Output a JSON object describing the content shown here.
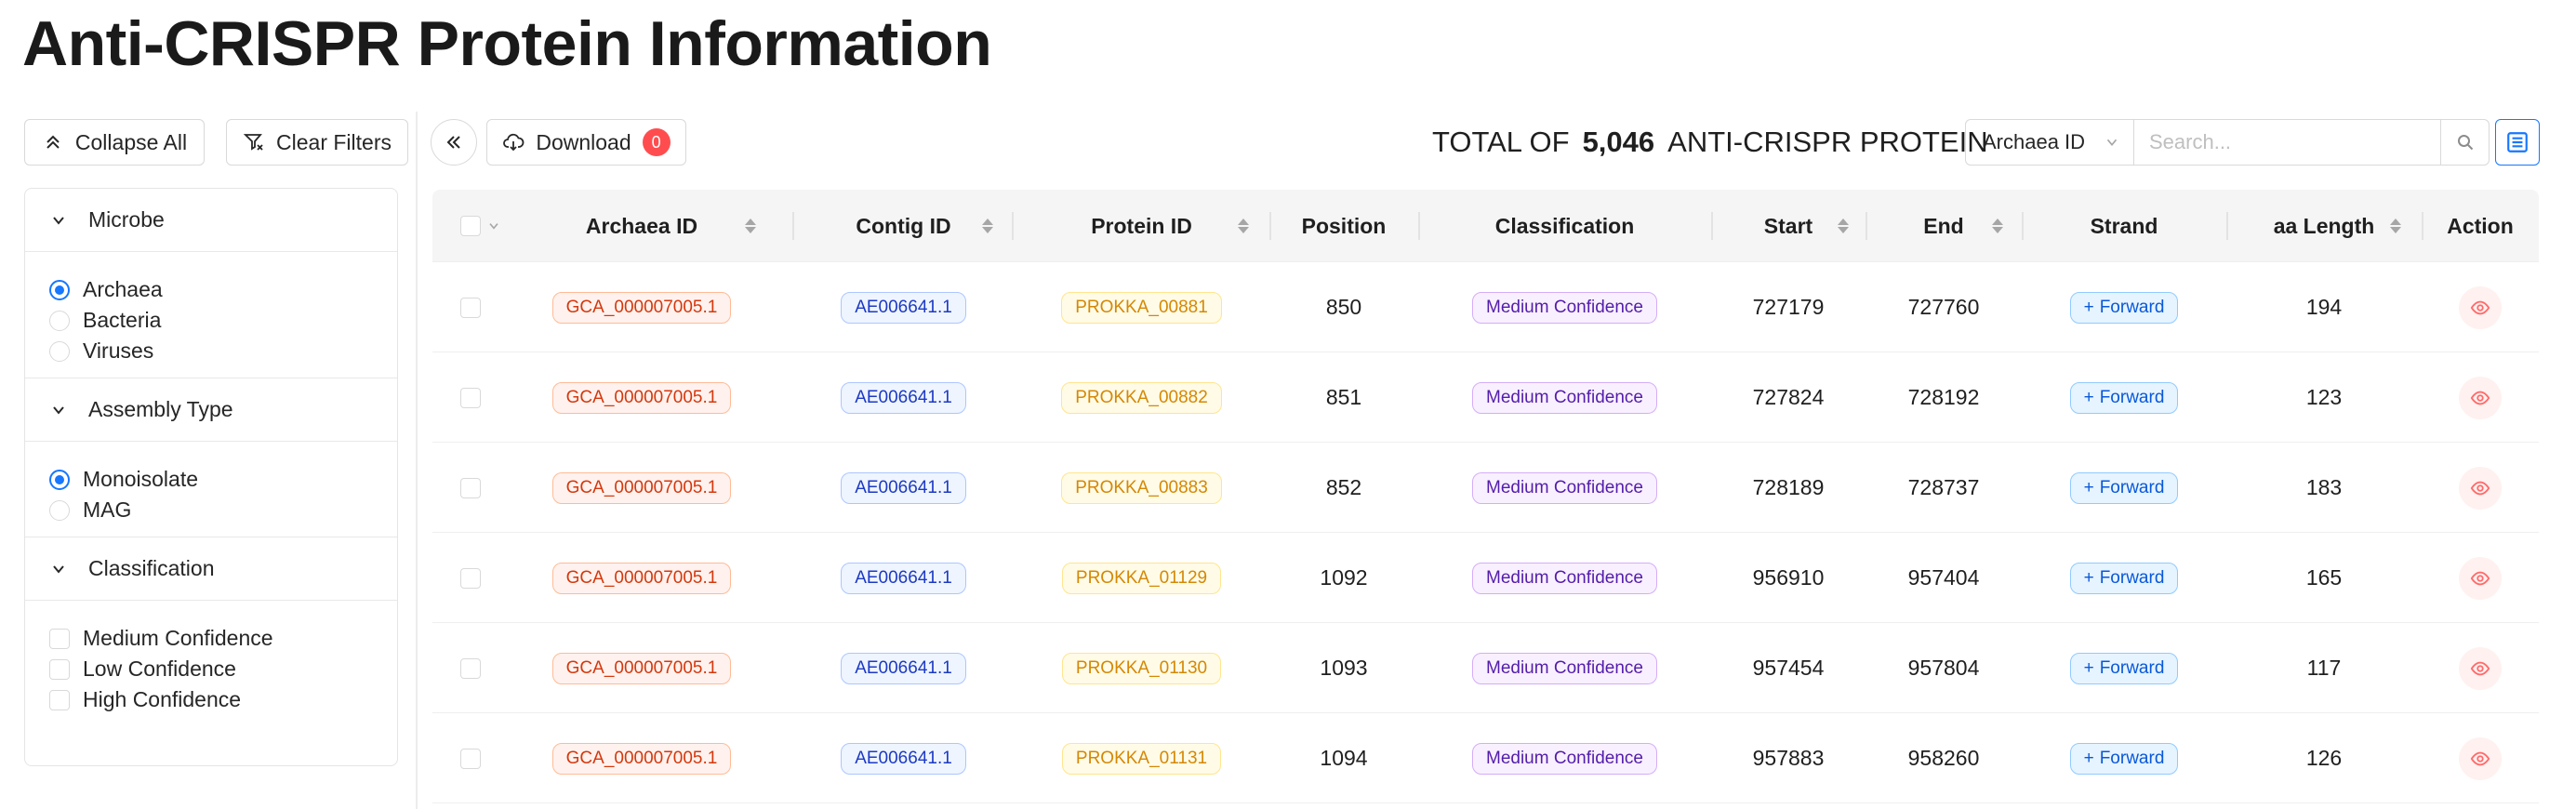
{
  "page": {
    "title": "Anti-CRISPR Protein Information"
  },
  "toolbar": {
    "collapse_label": "Collapse All",
    "clear_label": "Clear Filters",
    "download_label": "Download",
    "download_count": "0"
  },
  "summary": {
    "prefix": "TOTAL OF",
    "count": "5,046",
    "suffix": "ANTI-CRISPR PROTEIN"
  },
  "search": {
    "field": "Archaea ID",
    "placeholder": "Search..."
  },
  "filters": {
    "microbe": {
      "title": "Microbe",
      "options": [
        "Archaea",
        "Bacteria",
        "Viruses"
      ],
      "selected": "Archaea"
    },
    "assembly": {
      "title": "Assembly Type",
      "options": [
        "Monoisolate",
        "MAG"
      ],
      "selected": "Monoisolate"
    },
    "classification": {
      "title": "Classification",
      "options": [
        "Medium Confidence",
        "Low Confidence",
        "High Confidence"
      ]
    }
  },
  "table": {
    "columns": [
      "Archaea ID",
      "Contig ID",
      "Protein ID",
      "Position",
      "Classification",
      "Start",
      "End",
      "Strand",
      "aa Length",
      "Action"
    ],
    "rows": [
      {
        "archaea": "GCA_000007005.1",
        "contig": "AE006641.1",
        "protein": "PROKKA_00881",
        "position": "850",
        "classification": "Medium Confidence",
        "start": "727179",
        "end": "727760",
        "strand": "Forward",
        "aa_length": "194"
      },
      {
        "archaea": "GCA_000007005.1",
        "contig": "AE006641.1",
        "protein": "PROKKA_00882",
        "position": "851",
        "classification": "Medium Confidence",
        "start": "727824",
        "end": "728192",
        "strand": "Forward",
        "aa_length": "123"
      },
      {
        "archaea": "GCA_000007005.1",
        "contig": "AE006641.1",
        "protein": "PROKKA_00883",
        "position": "852",
        "classification": "Medium Confidence",
        "start": "728189",
        "end": "728737",
        "strand": "Forward",
        "aa_length": "183"
      },
      {
        "archaea": "GCA_000007005.1",
        "contig": "AE006641.1",
        "protein": "PROKKA_01129",
        "position": "1092",
        "classification": "Medium Confidence",
        "start": "956910",
        "end": "957404",
        "strand": "Forward",
        "aa_length": "165"
      },
      {
        "archaea": "GCA_000007005.1",
        "contig": "AE006641.1",
        "protein": "PROKKA_01130",
        "position": "1093",
        "classification": "Medium Confidence",
        "start": "957454",
        "end": "957804",
        "strand": "Forward",
        "aa_length": "117"
      },
      {
        "archaea": "GCA_000007005.1",
        "contig": "AE006641.1",
        "protein": "PROKKA_01131",
        "position": "1094",
        "classification": "Medium Confidence",
        "start": "957883",
        "end": "958260",
        "strand": "Forward",
        "aa_length": "126"
      }
    ]
  },
  "colors": {
    "accent": "#1677ff",
    "badge": "#ff4d4f",
    "archaea_tag": "#d4380d",
    "contig_tag": "#1d39c4",
    "protein_tag": "#d48806",
    "class_tag": "#531dab",
    "strand_tag": "#0958d9"
  }
}
